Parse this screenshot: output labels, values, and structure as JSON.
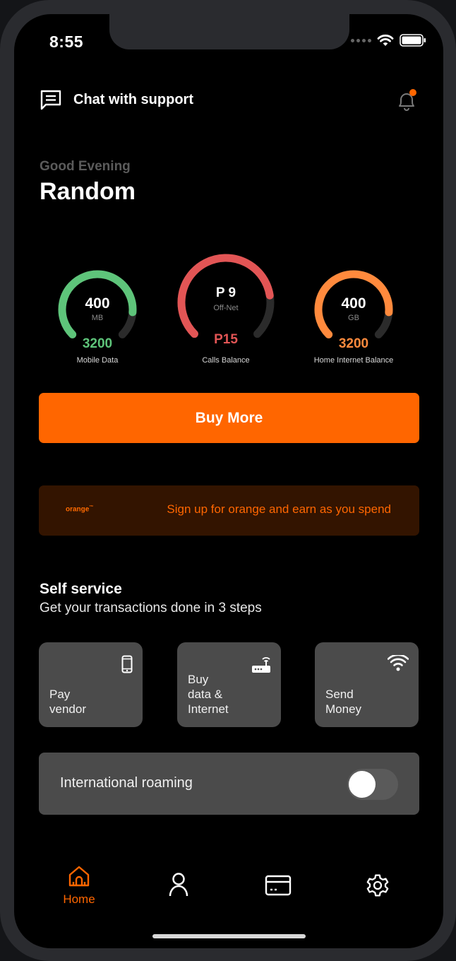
{
  "status_bar": {
    "time": "8:55"
  },
  "header": {
    "chat_label": "Chat with support"
  },
  "greeting": {
    "text": "Good Evening",
    "name": "Random"
  },
  "gauges": [
    {
      "value": "400",
      "unit": "MB",
      "total": "3200",
      "label": "Mobile Data",
      "color": "#5ec47a",
      "fraction": 0.85
    },
    {
      "value": "P 9",
      "unit": "Off-Net",
      "total": "P15",
      "label": "Calls Balance",
      "color": "#e25555",
      "fraction": 0.8
    },
    {
      "value": "400",
      "unit": "GB",
      "total": "3200",
      "label": "Home Internet Balance",
      "color": "#ff8a3d",
      "fraction": 0.85
    }
  ],
  "buy_more_label": "Buy More",
  "promo": {
    "logo": "orange",
    "logo_tm": "™",
    "text": "Sign up for orange and earn as you spend"
  },
  "self_service": {
    "title": "Self service",
    "subtitle": "Get your transactions done in 3 steps",
    "tiles": [
      {
        "label": "Pay\nvendor",
        "icon": "phone-icon"
      },
      {
        "label": "Buy\ndata &\nInternet",
        "icon": "router-icon"
      },
      {
        "label": "Send\nMoney",
        "icon": "wifi-icon"
      }
    ]
  },
  "roaming": {
    "label": "International roaming",
    "enabled": true
  },
  "tab_bar": {
    "items": [
      {
        "label": "Home",
        "icon": "home-icon",
        "active": true
      },
      {
        "label": "",
        "icon": "profile-icon"
      },
      {
        "label": "",
        "icon": "card-icon"
      },
      {
        "label": "",
        "icon": "settings-icon"
      }
    ]
  },
  "colors": {
    "accent": "#ff6600",
    "promo_bg": "#331400",
    "tile_bg": "#4b4b4b"
  }
}
